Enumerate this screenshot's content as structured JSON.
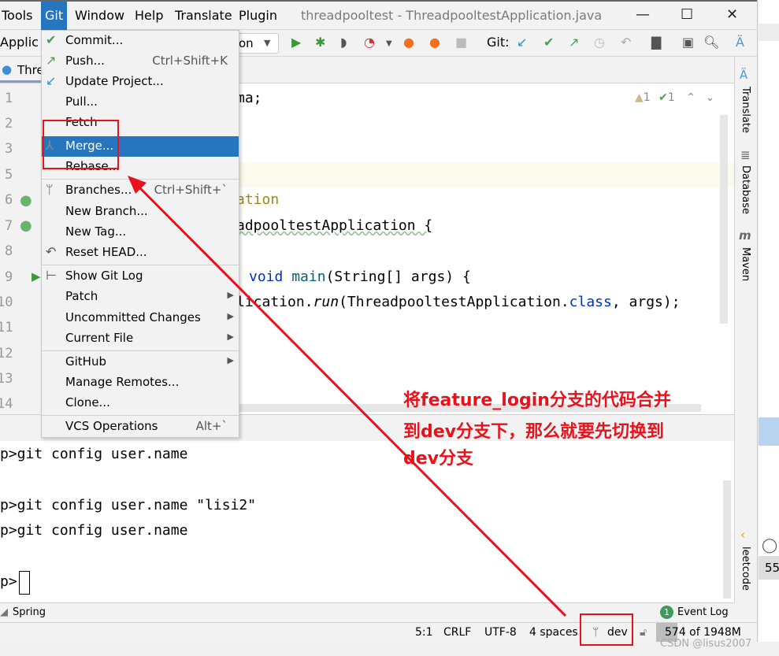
{
  "menubar": {
    "items": [
      "Tools",
      "Git",
      "Window",
      "Help",
      "Translate",
      "Plugin"
    ],
    "title": "threadpooltest - ThreadpooltestApplication.java"
  },
  "toolbar": {
    "config_partial": "Applic",
    "run_config_partial": "on",
    "git_label": "Git:"
  },
  "tab": {
    "label_partial": "Thre"
  },
  "editor": {
    "line_numbers": [
      "1",
      "2",
      "3",
      "5",
      "6",
      "7",
      "8",
      "9",
      "10",
      "11",
      "12",
      "13",
      "14"
    ],
    "lines": {
      "l1": "ma;",
      "l6": "ation",
      "l7": "adpooltestApplication {",
      "l9_kw": "void",
      "l9_fn": "main",
      "l9_rest": "(String[] args) {",
      "l10_a": "lication.",
      "l10_run": "run",
      "l10_b": "(ThreadpooltestApplication.",
      "l10_class": "class",
      "l10_c": ", args);"
    },
    "warnings": "1",
    "checks": "1"
  },
  "git_menu": {
    "items": [
      {
        "label": "Commit...",
        "icon": "check-icon"
      },
      {
        "label": "Push...",
        "shortcut": "Ctrl+Shift+K",
        "icon": "push-arrow-icon"
      },
      {
        "label": "Update Project...",
        "icon": "update-arrow-icon"
      },
      {
        "label": "Pull..."
      },
      {
        "label": "Fetch"
      },
      {
        "label": "Merge...",
        "icon": "merge-icon",
        "highlighted": true
      },
      {
        "label": "Rebase..."
      },
      {
        "label": "Branches...",
        "shortcut": "Ctrl+Shift+`",
        "icon": "branch-icon"
      },
      {
        "label": "New Branch..."
      },
      {
        "label": "New Tag..."
      },
      {
        "label": "Reset HEAD...",
        "icon": "reset-icon"
      },
      {
        "label": "Show Git Log",
        "icon": "git-log-icon"
      },
      {
        "label": "Patch",
        "submenu": true
      },
      {
        "label": "Uncommitted Changes",
        "submenu": true
      },
      {
        "label": "Current File",
        "submenu": true
      },
      {
        "label": "GitHub",
        "submenu": true
      },
      {
        "label": "Manage Remotes..."
      },
      {
        "label": "Clone..."
      },
      {
        "label": "VCS Operations",
        "shortcut": "Alt+`"
      }
    ]
  },
  "terminal": {
    "lines": [
      "p>git config user.name",
      "p>git config user.name \"lisi2\"",
      "p>git config user.name",
      "p>"
    ]
  },
  "toolstrip": {
    "spring": "Spring",
    "event_log": "Event Log",
    "event_count": "1"
  },
  "status": {
    "position": "5:1",
    "line_sep": "CRLF",
    "encoding": "UTF-8",
    "indent": "4 spaces",
    "branch": "dev",
    "memory": "574 of 1948M"
  },
  "right_bar": [
    "Translate",
    "Database",
    "Maven",
    "leetcode"
  ],
  "annotation": {
    "lines": [
      "将feature_login分支的代码合并",
      "到dev分支下，那么就要先切换到",
      "dev分支"
    ]
  },
  "watermark": "CSDN @lisus2007",
  "side_window": {
    "number": "55"
  },
  "colors": {
    "accent": "#2675bf",
    "annotation": "#e8121c",
    "keyword": "#0033b3",
    "annotation_code": "#9e880d"
  }
}
